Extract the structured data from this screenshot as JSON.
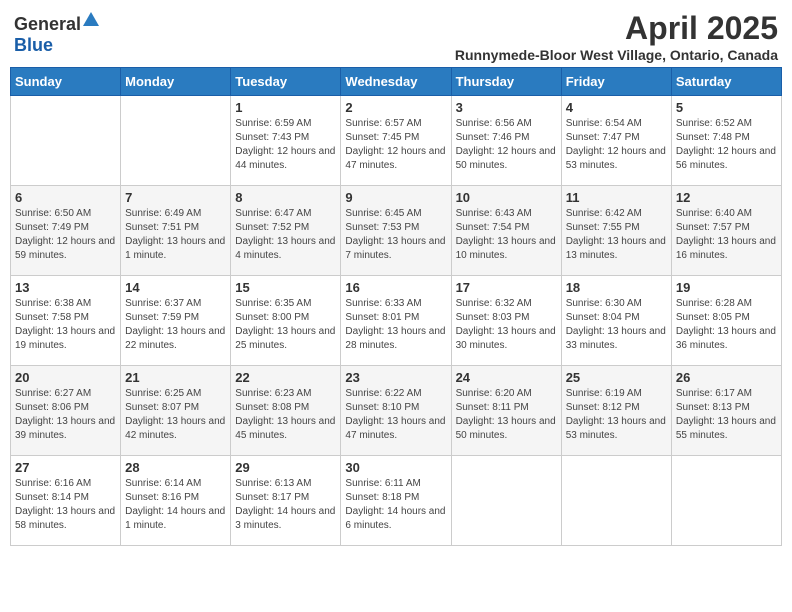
{
  "logo": {
    "text_general": "General",
    "text_blue": "Blue"
  },
  "title": "April 2025",
  "subtitle": "Runnymede-Bloor West Village, Ontario, Canada",
  "weekdays": [
    "Sunday",
    "Monday",
    "Tuesday",
    "Wednesday",
    "Thursday",
    "Friday",
    "Saturday"
  ],
  "weeks": [
    [
      {
        "day": "",
        "sunrise": "",
        "sunset": "",
        "daylight": ""
      },
      {
        "day": "",
        "sunrise": "",
        "sunset": "",
        "daylight": ""
      },
      {
        "day": "1",
        "sunrise": "Sunrise: 6:59 AM",
        "sunset": "Sunset: 7:43 PM",
        "daylight": "Daylight: 12 hours and 44 minutes."
      },
      {
        "day": "2",
        "sunrise": "Sunrise: 6:57 AM",
        "sunset": "Sunset: 7:45 PM",
        "daylight": "Daylight: 12 hours and 47 minutes."
      },
      {
        "day": "3",
        "sunrise": "Sunrise: 6:56 AM",
        "sunset": "Sunset: 7:46 PM",
        "daylight": "Daylight: 12 hours and 50 minutes."
      },
      {
        "day": "4",
        "sunrise": "Sunrise: 6:54 AM",
        "sunset": "Sunset: 7:47 PM",
        "daylight": "Daylight: 12 hours and 53 minutes."
      },
      {
        "day": "5",
        "sunrise": "Sunrise: 6:52 AM",
        "sunset": "Sunset: 7:48 PM",
        "daylight": "Daylight: 12 hours and 56 minutes."
      }
    ],
    [
      {
        "day": "6",
        "sunrise": "Sunrise: 6:50 AM",
        "sunset": "Sunset: 7:49 PM",
        "daylight": "Daylight: 12 hours and 59 minutes."
      },
      {
        "day": "7",
        "sunrise": "Sunrise: 6:49 AM",
        "sunset": "Sunset: 7:51 PM",
        "daylight": "Daylight: 13 hours and 1 minute."
      },
      {
        "day": "8",
        "sunrise": "Sunrise: 6:47 AM",
        "sunset": "Sunset: 7:52 PM",
        "daylight": "Daylight: 13 hours and 4 minutes."
      },
      {
        "day": "9",
        "sunrise": "Sunrise: 6:45 AM",
        "sunset": "Sunset: 7:53 PM",
        "daylight": "Daylight: 13 hours and 7 minutes."
      },
      {
        "day": "10",
        "sunrise": "Sunrise: 6:43 AM",
        "sunset": "Sunset: 7:54 PM",
        "daylight": "Daylight: 13 hours and 10 minutes."
      },
      {
        "day": "11",
        "sunrise": "Sunrise: 6:42 AM",
        "sunset": "Sunset: 7:55 PM",
        "daylight": "Daylight: 13 hours and 13 minutes."
      },
      {
        "day": "12",
        "sunrise": "Sunrise: 6:40 AM",
        "sunset": "Sunset: 7:57 PM",
        "daylight": "Daylight: 13 hours and 16 minutes."
      }
    ],
    [
      {
        "day": "13",
        "sunrise": "Sunrise: 6:38 AM",
        "sunset": "Sunset: 7:58 PM",
        "daylight": "Daylight: 13 hours and 19 minutes."
      },
      {
        "day": "14",
        "sunrise": "Sunrise: 6:37 AM",
        "sunset": "Sunset: 7:59 PM",
        "daylight": "Daylight: 13 hours and 22 minutes."
      },
      {
        "day": "15",
        "sunrise": "Sunrise: 6:35 AM",
        "sunset": "Sunset: 8:00 PM",
        "daylight": "Daylight: 13 hours and 25 minutes."
      },
      {
        "day": "16",
        "sunrise": "Sunrise: 6:33 AM",
        "sunset": "Sunset: 8:01 PM",
        "daylight": "Daylight: 13 hours and 28 minutes."
      },
      {
        "day": "17",
        "sunrise": "Sunrise: 6:32 AM",
        "sunset": "Sunset: 8:03 PM",
        "daylight": "Daylight: 13 hours and 30 minutes."
      },
      {
        "day": "18",
        "sunrise": "Sunrise: 6:30 AM",
        "sunset": "Sunset: 8:04 PM",
        "daylight": "Daylight: 13 hours and 33 minutes."
      },
      {
        "day": "19",
        "sunrise": "Sunrise: 6:28 AM",
        "sunset": "Sunset: 8:05 PM",
        "daylight": "Daylight: 13 hours and 36 minutes."
      }
    ],
    [
      {
        "day": "20",
        "sunrise": "Sunrise: 6:27 AM",
        "sunset": "Sunset: 8:06 PM",
        "daylight": "Daylight: 13 hours and 39 minutes."
      },
      {
        "day": "21",
        "sunrise": "Sunrise: 6:25 AM",
        "sunset": "Sunset: 8:07 PM",
        "daylight": "Daylight: 13 hours and 42 minutes."
      },
      {
        "day": "22",
        "sunrise": "Sunrise: 6:23 AM",
        "sunset": "Sunset: 8:08 PM",
        "daylight": "Daylight: 13 hours and 45 minutes."
      },
      {
        "day": "23",
        "sunrise": "Sunrise: 6:22 AM",
        "sunset": "Sunset: 8:10 PM",
        "daylight": "Daylight: 13 hours and 47 minutes."
      },
      {
        "day": "24",
        "sunrise": "Sunrise: 6:20 AM",
        "sunset": "Sunset: 8:11 PM",
        "daylight": "Daylight: 13 hours and 50 minutes."
      },
      {
        "day": "25",
        "sunrise": "Sunrise: 6:19 AM",
        "sunset": "Sunset: 8:12 PM",
        "daylight": "Daylight: 13 hours and 53 minutes."
      },
      {
        "day": "26",
        "sunrise": "Sunrise: 6:17 AM",
        "sunset": "Sunset: 8:13 PM",
        "daylight": "Daylight: 13 hours and 55 minutes."
      }
    ],
    [
      {
        "day": "27",
        "sunrise": "Sunrise: 6:16 AM",
        "sunset": "Sunset: 8:14 PM",
        "daylight": "Daylight: 13 hours and 58 minutes."
      },
      {
        "day": "28",
        "sunrise": "Sunrise: 6:14 AM",
        "sunset": "Sunset: 8:16 PM",
        "daylight": "Daylight: 14 hours and 1 minute."
      },
      {
        "day": "29",
        "sunrise": "Sunrise: 6:13 AM",
        "sunset": "Sunset: 8:17 PM",
        "daylight": "Daylight: 14 hours and 3 minutes."
      },
      {
        "day": "30",
        "sunrise": "Sunrise: 6:11 AM",
        "sunset": "Sunset: 8:18 PM",
        "daylight": "Daylight: 14 hours and 6 minutes."
      },
      {
        "day": "",
        "sunrise": "",
        "sunset": "",
        "daylight": ""
      },
      {
        "day": "",
        "sunrise": "",
        "sunset": "",
        "daylight": ""
      },
      {
        "day": "",
        "sunrise": "",
        "sunset": "",
        "daylight": ""
      }
    ]
  ]
}
